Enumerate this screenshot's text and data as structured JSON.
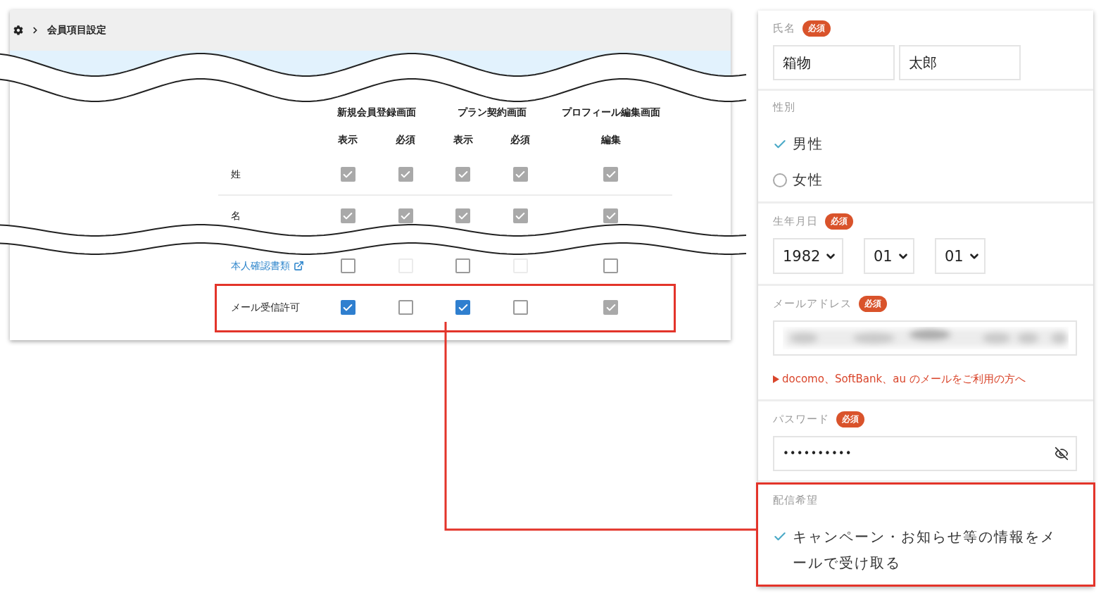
{
  "breadcrumb": {
    "title": "会員項目設定"
  },
  "settings_table": {
    "groups": [
      {
        "label": "新規会員登録画面",
        "columns": [
          "表示",
          "必須"
        ]
      },
      {
        "label": "プラン契約画面",
        "columns": [
          "表示",
          "必須"
        ]
      },
      {
        "label": "プロフィール編集画面",
        "columns": [
          "編集"
        ]
      }
    ],
    "rows": [
      {
        "label": "姓",
        "kind": "text",
        "highlighted": false,
        "checks": [
          {
            "checked": true,
            "disabled": true
          },
          {
            "checked": true,
            "disabled": true
          },
          {
            "checked": true,
            "disabled": true
          },
          {
            "checked": true,
            "disabled": true
          },
          {
            "checked": true,
            "disabled": true
          }
        ]
      },
      {
        "label": "名",
        "kind": "text",
        "highlighted": false,
        "checks": [
          {
            "checked": true,
            "disabled": true
          },
          {
            "checked": true,
            "disabled": true
          },
          {
            "checked": true,
            "disabled": true
          },
          {
            "checked": true,
            "disabled": true
          },
          {
            "checked": true,
            "disabled": true
          }
        ]
      },
      {
        "label": "本人確認書類",
        "kind": "link",
        "highlighted": false,
        "checks": [
          {
            "checked": false,
            "disabled": false
          },
          {
            "checked": false,
            "disabled": true
          },
          {
            "checked": false,
            "disabled": false
          },
          {
            "checked": false,
            "disabled": true
          },
          {
            "checked": false,
            "disabled": false
          }
        ]
      },
      {
        "label": "メール受信許可",
        "kind": "text",
        "highlighted": true,
        "checks": [
          {
            "checked": true,
            "disabled": false
          },
          {
            "checked": false,
            "disabled": false
          },
          {
            "checked": true,
            "disabled": false
          },
          {
            "checked": false,
            "disabled": false
          },
          {
            "checked": true,
            "disabled": true
          }
        ]
      }
    ]
  },
  "form": {
    "sections": [
      {
        "kind": "name",
        "label": "氏名",
        "badge": "必須",
        "highlighted": false,
        "values": [
          "箱物",
          "太郎"
        ]
      },
      {
        "kind": "radio",
        "label": "性別",
        "highlighted": false,
        "options": [
          {
            "label": "男性",
            "selected": true
          },
          {
            "label": "女性",
            "selected": false
          }
        ]
      },
      {
        "kind": "date",
        "label": "生年月日",
        "badge": "必須",
        "highlighted": false,
        "selects": [
          "1982",
          "01",
          "01"
        ]
      },
      {
        "kind": "email",
        "label": "メールアドレス",
        "badge": "必須",
        "highlighted": false,
        "note": "docomo、SoftBank、au のメールをご利用の方へ"
      },
      {
        "kind": "password",
        "label": "パスワード",
        "badge": "必須",
        "highlighted": false,
        "value": "••••••••••"
      },
      {
        "kind": "checkbox",
        "label": "配信希望",
        "highlighted": true,
        "options": [
          {
            "label": "キャンペーン・お知らせ等の情報をメールで受け取る",
            "checked": true
          }
        ]
      }
    ]
  }
}
